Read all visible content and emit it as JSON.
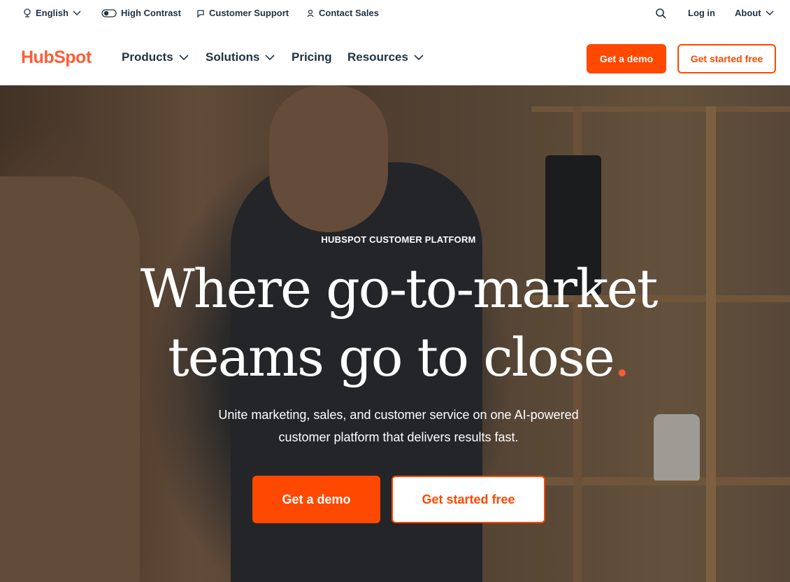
{
  "utility": {
    "language": "English",
    "contrast": "High Contrast",
    "support": "Customer Support",
    "sales": "Contact Sales",
    "login": "Log in",
    "about": "About"
  },
  "nav": {
    "logo": "HubSpot",
    "products": "Products",
    "solutions": "Solutions",
    "pricing": "Pricing",
    "resources": "Resources",
    "demo": "Get a demo",
    "free": "Get started free"
  },
  "hero": {
    "eyebrow": "HUBSPOT CUSTOMER PLATFORM",
    "headline_line1": "Where go-to-market",
    "headline_line2": "teams go to close",
    "headline_dot": ".",
    "subtext_line1": "Unite marketing, sales, and customer service on one AI-powered",
    "subtext_line2": "customer platform that delivers results fast.",
    "demo": "Get a demo",
    "free": "Get started free"
  },
  "colors": {
    "brand": "#ff4800",
    "logo": "#ff5c35",
    "text": "#213343"
  },
  "icons": [
    "globe-icon",
    "contrast-toggle-icon",
    "chat-icon",
    "person-icon",
    "search-icon",
    "chevron-down-icon"
  ]
}
